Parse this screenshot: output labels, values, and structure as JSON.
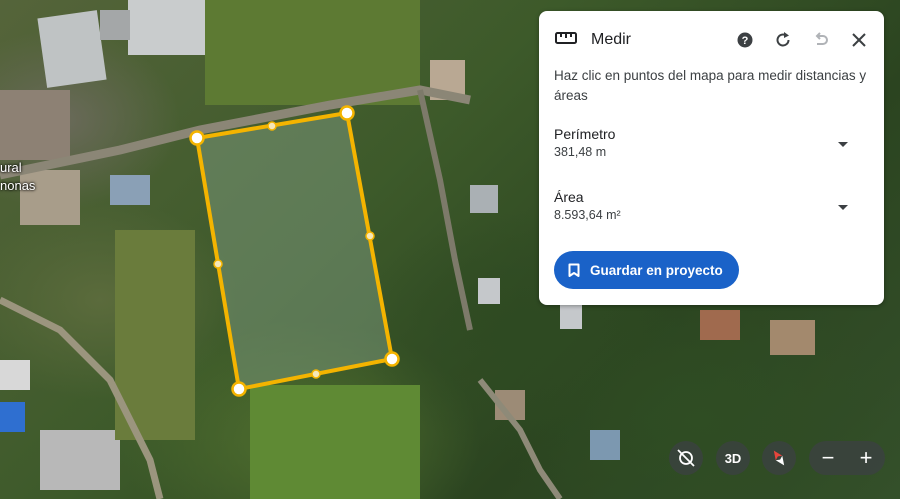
{
  "map": {
    "place_label_1": "ural",
    "place_label_2": "nonas"
  },
  "panel": {
    "title": "Medir",
    "description": "Haz clic en puntos del mapa para medir distancias y áreas",
    "perimeter_label": "Perímetro",
    "perimeter_value": "381,48 m",
    "area_label": "Área",
    "area_value": "8.593,64 m²",
    "save_label": "Guardar en proyecto"
  },
  "controls": {
    "btn_3d": "3D",
    "zoom_out": "−",
    "zoom_in": "+"
  },
  "colors": {
    "measure_line": "#f4b400",
    "primary_button": "#1a62c8"
  }
}
